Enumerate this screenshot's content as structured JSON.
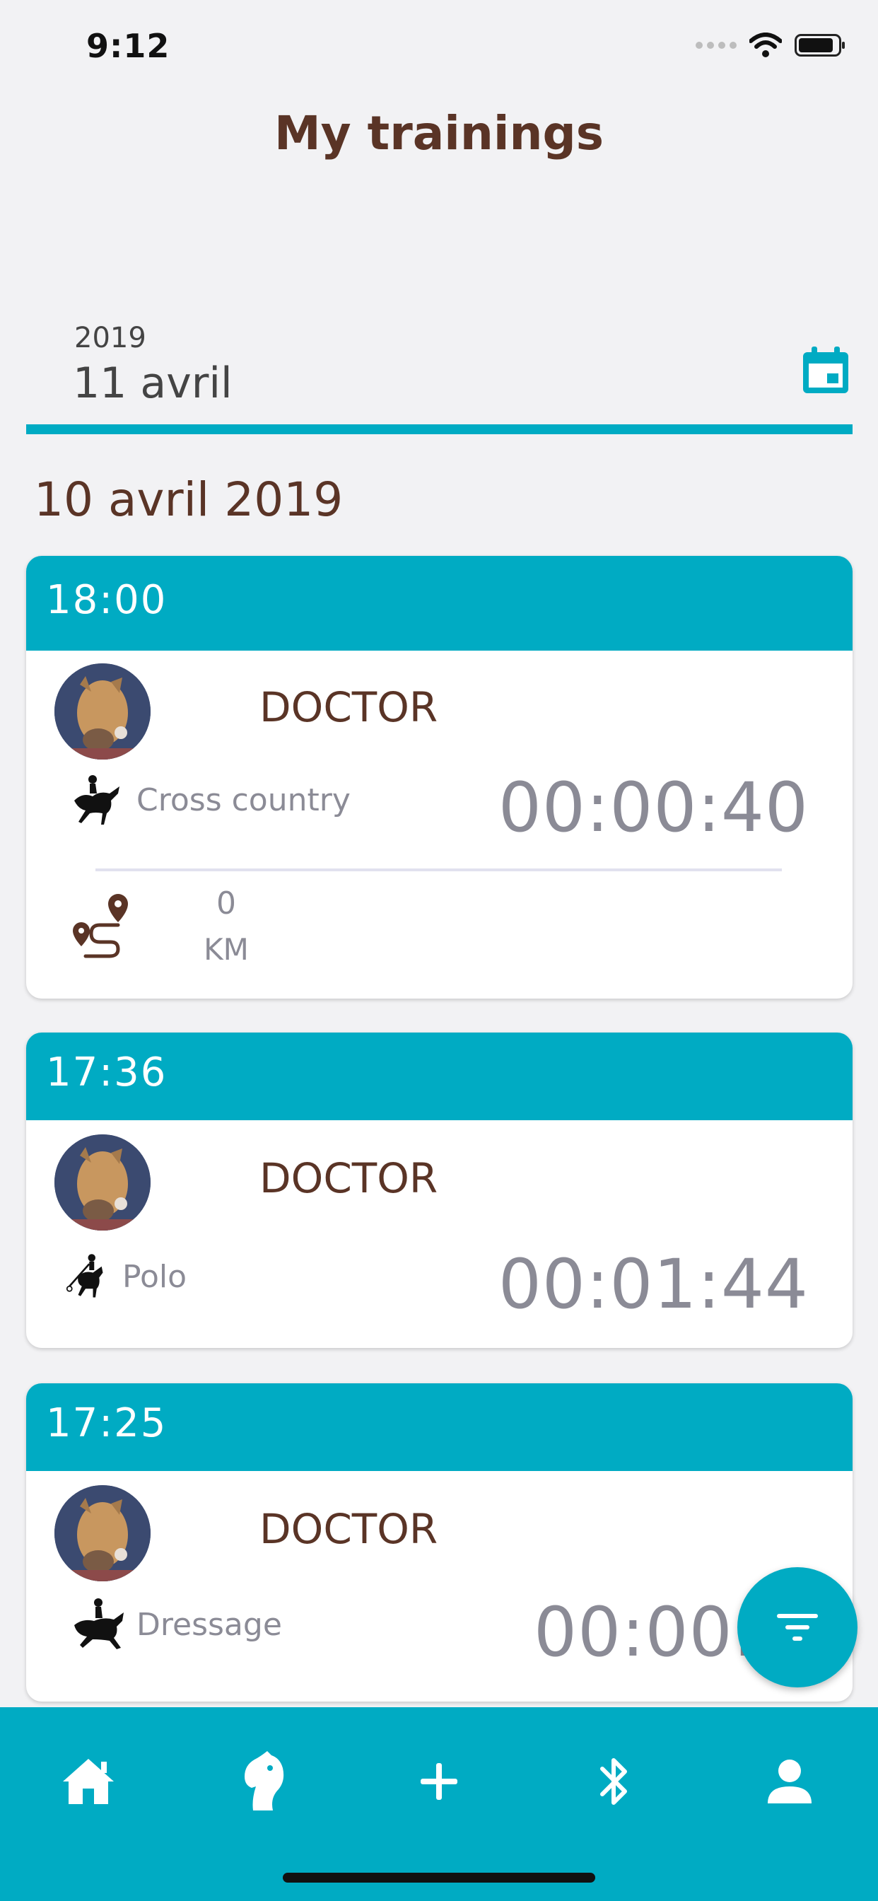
{
  "status_bar": {
    "time": "9:12"
  },
  "header": {
    "title": "My trainings"
  },
  "date_picker": {
    "year": "2019",
    "day": "11 avril"
  },
  "section": {
    "date": "10 avril 2019"
  },
  "trainings": [
    {
      "time": "18:00",
      "horse": "DOCTOR",
      "discipline": "Cross country",
      "duration": "00:00:40",
      "distance_value": "0",
      "distance_unit": "KM"
    },
    {
      "time": "17:36",
      "horse": "DOCTOR",
      "discipline": "Polo",
      "duration": "00:01:44"
    },
    {
      "time": "17:25",
      "horse": "DOCTOR",
      "discipline": "Dressage",
      "duration": "00:00:2"
    }
  ],
  "tabs": [
    "home-icon",
    "horse-head-icon",
    "plus-icon",
    "bluetooth-icon",
    "profile-icon"
  ],
  "colors": {
    "accent": "#00abc3",
    "brown": "#5a3426",
    "gray_text": "#8b8b96",
    "background": "#f2f2f4"
  }
}
